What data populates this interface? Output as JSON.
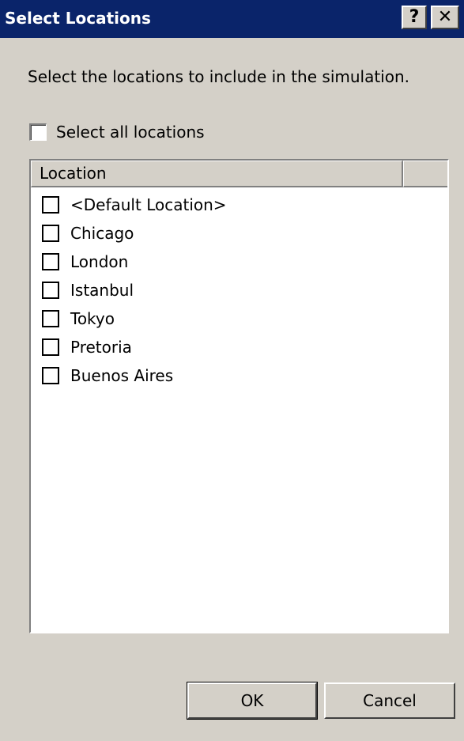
{
  "window": {
    "title": "Select Locations",
    "help_label": "?",
    "close_label": "✕"
  },
  "instructions": "Select the locations to include in the simulation.",
  "select_all": {
    "label": "Select all locations",
    "checked": false
  },
  "listview": {
    "columns": [
      "Location",
      ""
    ],
    "items": [
      {
        "label": "<Default Location>",
        "checked": false
      },
      {
        "label": "Chicago",
        "checked": false
      },
      {
        "label": "London",
        "checked": false
      },
      {
        "label": "Istanbul",
        "checked": false
      },
      {
        "label": "Tokyo",
        "checked": false
      },
      {
        "label": "Pretoria",
        "checked": false
      },
      {
        "label": "Buenos Aires",
        "checked": false
      }
    ]
  },
  "buttons": {
    "ok_label": "OK",
    "cancel_label": "Cancel"
  },
  "colors": {
    "titlebar": "#0a246a",
    "dialog_face": "#d4d0c8",
    "list_background": "#ffffff"
  }
}
